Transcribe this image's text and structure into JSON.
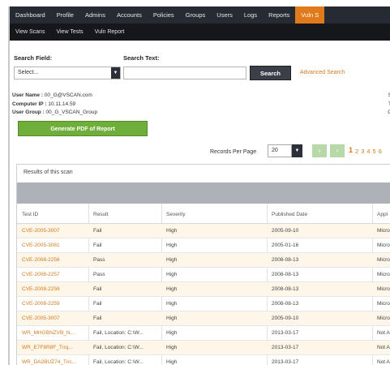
{
  "nav": {
    "items": [
      "Dashboard",
      "Profile",
      "Admins",
      "Accounts",
      "Policies",
      "Groups",
      "Users",
      "Logs",
      "Reports",
      "Vuln S"
    ],
    "active_index": 9
  },
  "subnav": {
    "items": [
      "View Scans",
      "View Tests",
      "Vuln Report"
    ]
  },
  "search": {
    "field_label": "Search Field:",
    "text_label": "Search Text:",
    "select_value": "Select...",
    "input_value": "",
    "button_label": "Search",
    "advanced_label": "Advanced Search"
  },
  "user": {
    "name_label": "User Name :",
    "name_value": "00_G@VSCAN.com",
    "ip_label": "Computer IP :",
    "ip_value": "10.11.14.59",
    "group_label": "User Group :",
    "group_value": "00_G_VSCAN_Group",
    "right_glyphs": [
      "S",
      "T",
      "C"
    ]
  },
  "generate_button": "Generate PDF of Report",
  "pager": {
    "label": "Records Per Page",
    "per_page": "20",
    "pages": [
      "1",
      "2",
      "3",
      "4",
      "5",
      "6"
    ],
    "current": "1"
  },
  "results": {
    "title": "Results of this scan",
    "columns": [
      "Test ID",
      "Result",
      "Severity",
      "Published Date",
      "Appl"
    ],
    "rows": [
      [
        "CVE-2005-3007",
        "Fail",
        "High",
        "2005-09-10",
        "Micro"
      ],
      [
        "CVE-2005-3081",
        "Fail",
        "High",
        "2005-01-16",
        "Micro"
      ],
      [
        "CVE-2008-2256",
        "Pass",
        "High",
        "2008-08-13",
        "Micro"
      ],
      [
        "CVE-2008-2257",
        "Pass",
        "High",
        "2008-08-13",
        "Micro"
      ],
      [
        "CVE-2008-2258",
        "Fail",
        "High",
        "2008-08-13",
        "Micro"
      ],
      [
        "CVE-2008-2259",
        "Fail",
        "High",
        "2008-08-13",
        "Micro"
      ],
      [
        "CVE-2005-3007",
        "Fail",
        "High",
        "2005-09-10",
        "Micro"
      ],
      [
        "WR_MHGBNZVB_N...",
        "Fail, Location: C:\\W...",
        "High",
        "2013-03-17",
        "Not A"
      ],
      [
        "WR_E7F8R8F_Tnq...",
        "Fail, Location: C:\\W...",
        "High",
        "2013-03-17",
        "Not A"
      ],
      [
        "WR_DA2BUZ74_Tnc...",
        "Fail, Location: C:\\W...",
        "High",
        "2013-03-17",
        "Not A"
      ]
    ]
  }
}
